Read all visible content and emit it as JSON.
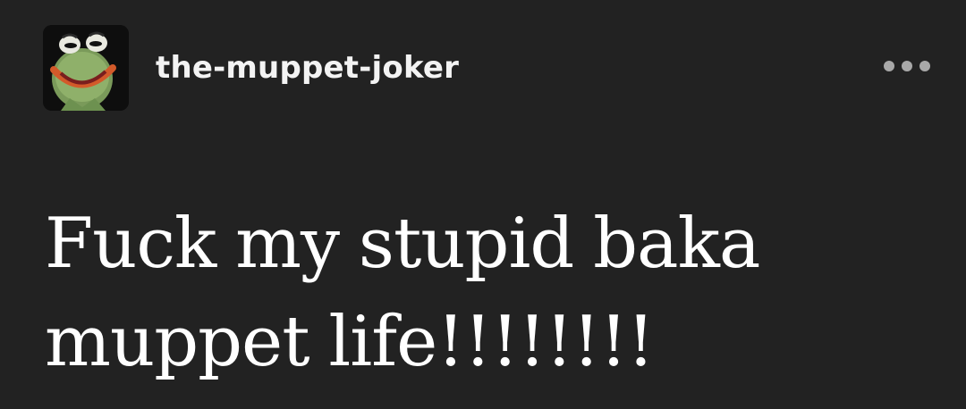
{
  "post": {
    "username": "the-muppet-joker",
    "body_text": "Fuck my stupid baka\nmuppet life!!!!!!!!",
    "avatar_icon": "kermit-joker-avatar",
    "more_icon": "more-options-icon"
  },
  "colors": {
    "background": "#222222",
    "text": "#ffffff",
    "muted": "#a8a8a8"
  }
}
